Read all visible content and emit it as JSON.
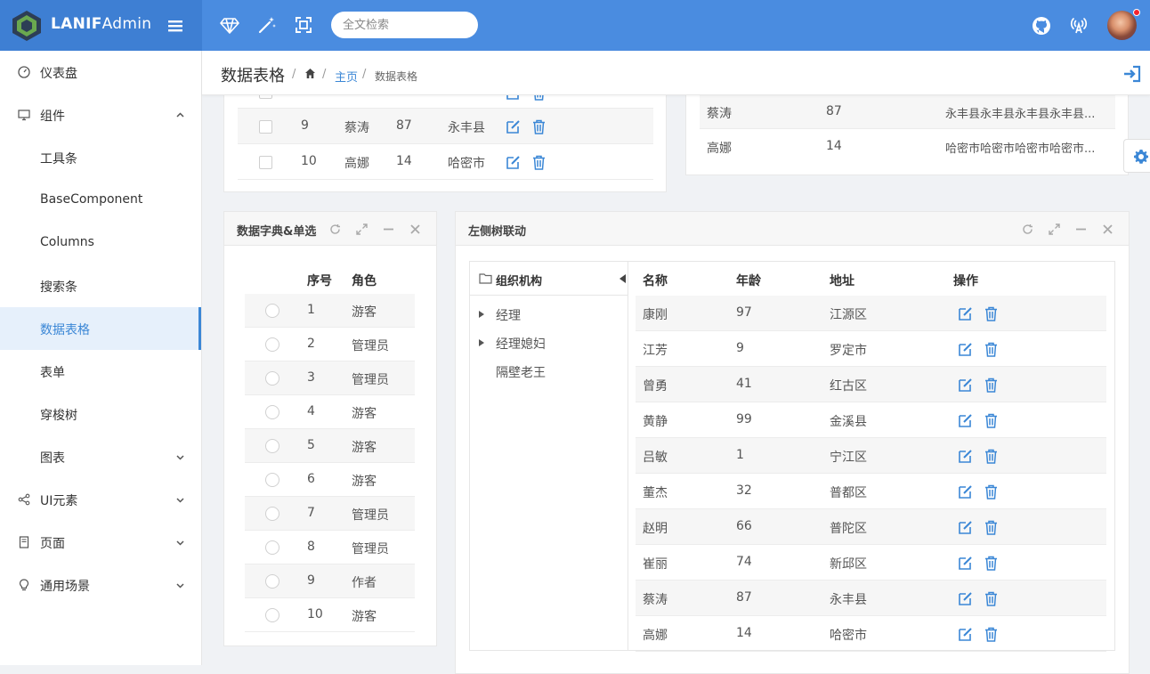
{
  "app": {
    "brand_bold": "LANIF",
    "brand_light": "Admin"
  },
  "search": {
    "placeholder": "全文检索"
  },
  "sidebar": {
    "items": [
      {
        "label": "仪表盘"
      },
      {
        "label": "组件"
      },
      {
        "label": "工具条"
      },
      {
        "label": "BaseComponent"
      },
      {
        "label": "Columns"
      },
      {
        "label": "搜索条"
      },
      {
        "label": "数据表格"
      },
      {
        "label": "表单"
      },
      {
        "label": "穿梭树"
      },
      {
        "label": "图表"
      },
      {
        "label": "UI元素"
      },
      {
        "label": "页面"
      },
      {
        "label": "通用场景"
      }
    ]
  },
  "header": {
    "title": "数据表格",
    "crumb_home": "主页",
    "crumb_current": "数据表格",
    "sep": "/"
  },
  "top_left_table": {
    "rows": [
      {
        "id": "9",
        "name": "蔡涛",
        "age": "87",
        "addr": "永丰县"
      },
      {
        "id": "10",
        "name": "高娜",
        "age": "14",
        "addr": "哈密市"
      }
    ]
  },
  "top_right_table": {
    "rows": [
      {
        "name": "蔡涛",
        "age": "87",
        "addr": "永丰县永丰县永丰县永丰县..."
      },
      {
        "name": "高娜",
        "age": "14",
        "addr": "哈密市哈密市哈密市哈密市..."
      }
    ]
  },
  "dict_card": {
    "title": "数据字典&单选",
    "col_id": "序号",
    "col_role": "角色",
    "rows": [
      {
        "id": "1",
        "role": "游客"
      },
      {
        "id": "2",
        "role": "管理员"
      },
      {
        "id": "3",
        "role": "管理员"
      },
      {
        "id": "4",
        "role": "游客"
      },
      {
        "id": "5",
        "role": "游客"
      },
      {
        "id": "6",
        "role": "游客"
      },
      {
        "id": "7",
        "role": "管理员"
      },
      {
        "id": "8",
        "role": "管理员"
      },
      {
        "id": "9",
        "role": "作者"
      },
      {
        "id": "10",
        "role": "游客"
      }
    ]
  },
  "tree_card": {
    "title": "左侧树联动",
    "tree_title": "组织机构",
    "tree_items": [
      "经理",
      "经理媳妇",
      "隔壁老王"
    ],
    "col_name": "名称",
    "col_age": "年龄",
    "col_addr": "地址",
    "col_ops": "操作",
    "rows": [
      {
        "name": "康刚",
        "age": "97",
        "addr": "江源区"
      },
      {
        "name": "江芳",
        "age": "9",
        "addr": "罗定市"
      },
      {
        "name": "曾勇",
        "age": "41",
        "addr": "红古区"
      },
      {
        "name": "黄静",
        "age": "99",
        "addr": "金溪县"
      },
      {
        "name": "吕敏",
        "age": "1",
        "addr": "宁江区"
      },
      {
        "name": "董杰",
        "age": "32",
        "addr": "普都区"
      },
      {
        "name": "赵明",
        "age": "66",
        "addr": "普陀区"
      },
      {
        "name": "崔丽",
        "age": "74",
        "addr": "新邱区"
      },
      {
        "name": "蔡涛",
        "age": "87",
        "addr": "永丰县"
      },
      {
        "name": "高娜",
        "age": "14",
        "addr": "哈密市"
      }
    ]
  },
  "colors": {
    "primary": "#4a8ce0",
    "brand": "#3e7fd3",
    "link": "#3b87d6",
    "badge": "#f5222d"
  }
}
